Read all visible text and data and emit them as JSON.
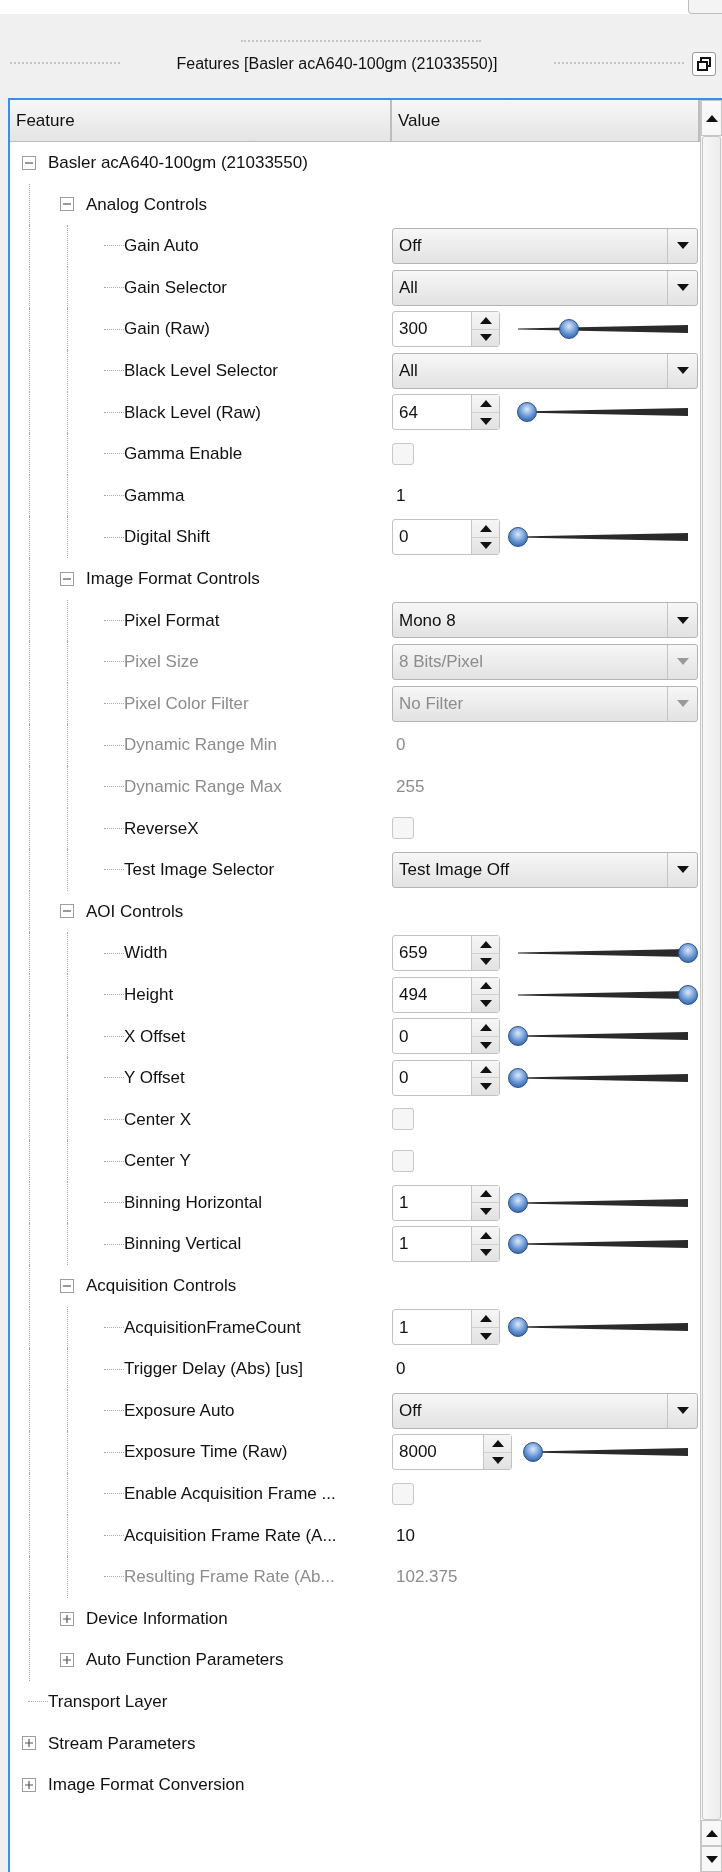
{
  "window": {
    "title": "Features [Basler acA640-100gm (21033550)]"
  },
  "table": {
    "columns": [
      "Feature",
      "Value"
    ],
    "tree": [
      {
        "label": "Basler acA640-100gm (21033550)",
        "expanded": true,
        "children": [
          {
            "label": "Analog Controls",
            "expanded": true,
            "children": [
              {
                "label": "Gain Auto",
                "disabled": false,
                "value": {
                  "kind": "combo",
                  "text": "Off"
                }
              },
              {
                "label": "Gain Selector",
                "disabled": false,
                "value": {
                  "kind": "combo",
                  "text": "All"
                }
              },
              {
                "label": "Gain (Raw)",
                "disabled": false,
                "value": {
                  "kind": "spin",
                  "text": "300",
                  "level": 0.3
                }
              },
              {
                "label": "Black Level Selector",
                "disabled": false,
                "value": {
                  "kind": "combo",
                  "text": "All"
                }
              },
              {
                "label": "Black Level (Raw)",
                "disabled": false,
                "value": {
                  "kind": "spin",
                  "text": "64",
                  "level": 0.05
                }
              },
              {
                "label": "Gamma Enable",
                "disabled": false,
                "value": {
                  "kind": "check",
                  "checked": false
                }
              },
              {
                "label": "Gamma",
                "disabled": false,
                "value": {
                  "kind": "text",
                  "text": "1"
                }
              },
              {
                "label": "Digital Shift",
                "disabled": false,
                "value": {
                  "kind": "spin",
                  "text": "0",
                  "level": 0
                }
              }
            ]
          },
          {
            "label": "Image Format Controls",
            "expanded": true,
            "children": [
              {
                "label": "Pixel Format",
                "disabled": false,
                "value": {
                  "kind": "combo",
                  "text": "Mono 8"
                }
              },
              {
                "label": "Pixel Size",
                "disabled": true,
                "value": {
                  "kind": "combo",
                  "text": "8 Bits/Pixel"
                }
              },
              {
                "label": "Pixel Color Filter",
                "disabled": true,
                "value": {
                  "kind": "combo",
                  "text": "No Filter"
                }
              },
              {
                "label": "Dynamic Range Min",
                "disabled": true,
                "value": {
                  "kind": "text",
                  "text": "0"
                }
              },
              {
                "label": "Dynamic Range Max",
                "disabled": true,
                "value": {
                  "kind": "text",
                  "text": "255"
                }
              },
              {
                "label": "ReverseX",
                "disabled": false,
                "value": {
                  "kind": "check",
                  "checked": false
                }
              },
              {
                "label": "Test Image Selector",
                "disabled": false,
                "value": {
                  "kind": "combo",
                  "text": "Test Image Off"
                }
              }
            ]
          },
          {
            "label": "AOI Controls",
            "expanded": true,
            "children": [
              {
                "label": "Width",
                "disabled": false,
                "value": {
                  "kind": "spin",
                  "text": "659",
                  "level": 1
                }
              },
              {
                "label": "Height",
                "disabled": false,
                "value": {
                  "kind": "spin",
                  "text": "494",
                  "level": 1
                }
              },
              {
                "label": "X Offset",
                "disabled": false,
                "value": {
                  "kind": "spin",
                  "text": "0",
                  "level": 0
                }
              },
              {
                "label": "Y Offset",
                "disabled": false,
                "value": {
                  "kind": "spin",
                  "text": "0",
                  "level": 0
                }
              },
              {
                "label": "Center X",
                "disabled": false,
                "value": {
                  "kind": "check",
                  "checked": false
                }
              },
              {
                "label": "Center Y",
                "disabled": false,
                "value": {
                  "kind": "check",
                  "checked": false
                }
              },
              {
                "label": "Binning Horizontal",
                "disabled": false,
                "value": {
                  "kind": "spin",
                  "text": "1",
                  "level": 0
                }
              },
              {
                "label": "Binning Vertical",
                "disabled": false,
                "value": {
                  "kind": "spin",
                  "text": "1",
                  "level": 0
                }
              }
            ]
          },
          {
            "label": "Acquisition Controls",
            "expanded": true,
            "children": [
              {
                "label": "AcquisitionFrameCount",
                "disabled": false,
                "value": {
                  "kind": "spin",
                  "text": "1",
                  "level": 0
                }
              },
              {
                "label": "Trigger Delay (Abs) [us]",
                "disabled": false,
                "value": {
                  "kind": "text",
                  "text": "0"
                }
              },
              {
                "label": "Exposure Auto",
                "disabled": false,
                "value": {
                  "kind": "combo",
                  "text": "Off"
                }
              },
              {
                "label": "Exposure Time (Raw)",
                "disabled": false,
                "value": {
                  "kind": "spin",
                  "text": "8000",
                  "level": 0.02
                }
              },
              {
                "label": "Enable Acquisition Frame ...",
                "disabled": false,
                "value": {
                  "kind": "check",
                  "checked": false
                }
              },
              {
                "label": "Acquisition Frame Rate (A...",
                "disabled": false,
                "value": {
                  "kind": "text",
                  "text": "10"
                }
              },
              {
                "label": "Resulting Frame Rate (Ab...",
                "disabled": true,
                "value": {
                  "kind": "text",
                  "text": "102.375"
                }
              }
            ]
          },
          {
            "label": "Device Information",
            "expanded": false
          },
          {
            "label": "Auto Function Parameters",
            "expanded": false
          }
        ]
      },
      {
        "label": "Transport Layer"
      },
      {
        "label": "Stream Parameters",
        "expanded": false
      },
      {
        "label": "Image Format Conversion",
        "expanded": false
      }
    ]
  }
}
